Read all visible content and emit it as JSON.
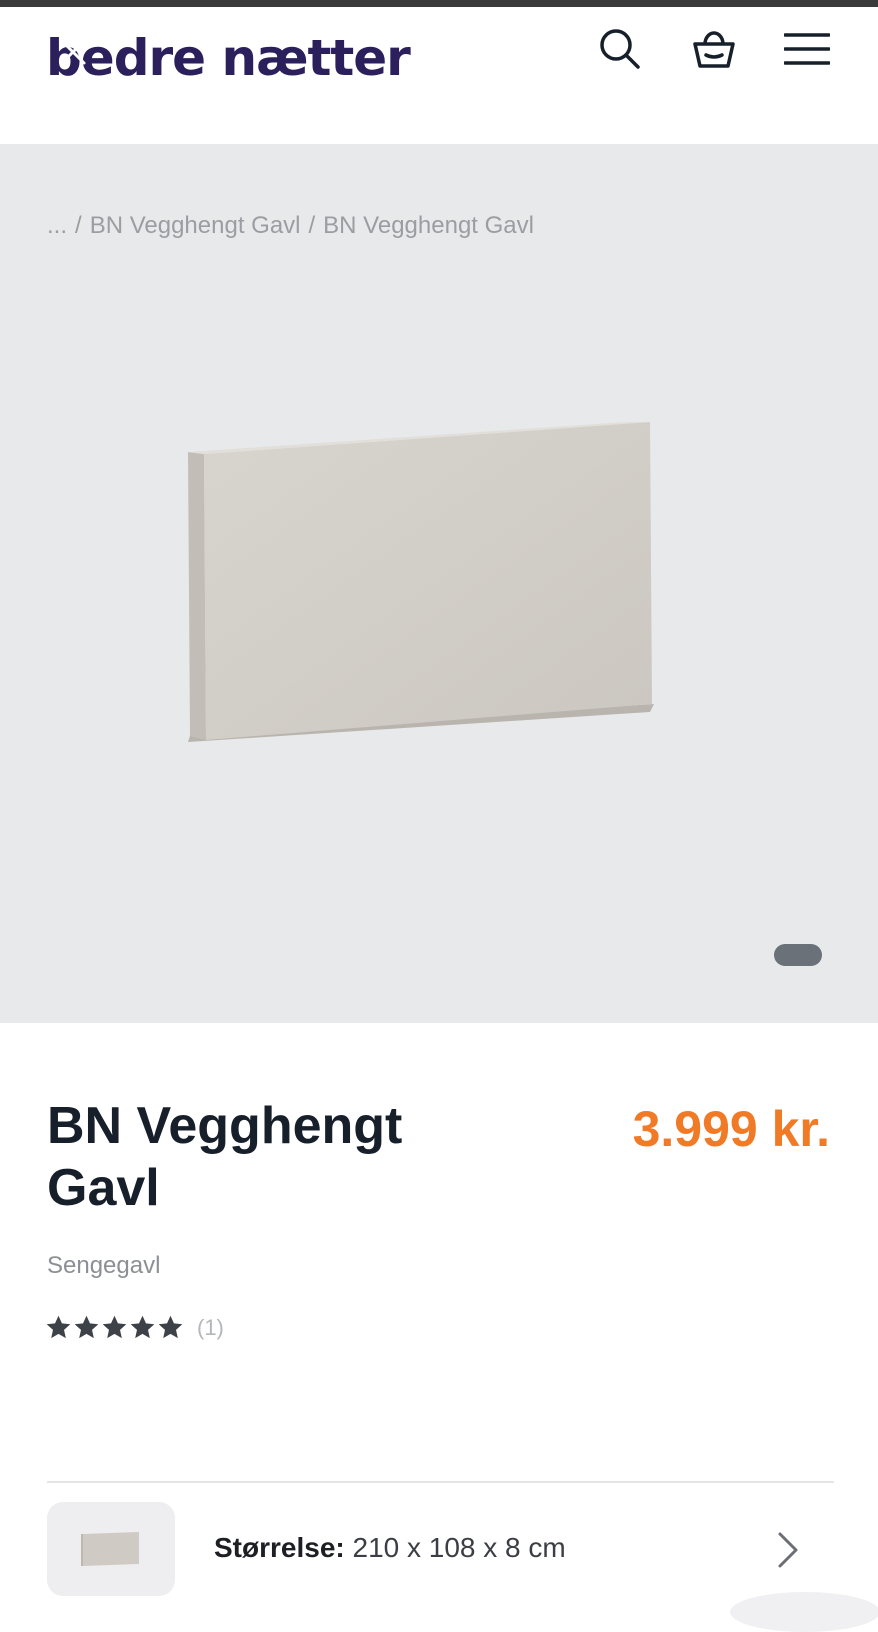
{
  "header": {
    "logo_text": "bedre nætter",
    "icons": [
      "close-icon",
      "moon-icon",
      "search-icon",
      "basket-icon",
      "menu-icon"
    ]
  },
  "breadcrumb": {
    "items": [
      "...",
      "BN Vegghengt Gavl",
      "BN Vegghengt Gavl"
    ],
    "separator": "/"
  },
  "gallery": {
    "active_index": 0,
    "total": 1
  },
  "product": {
    "title": "BN Vegghengt Gavl",
    "price": "3.999 kr.",
    "category": "Sengegavl",
    "rating": 5,
    "review_count": "(1)"
  },
  "size_selector": {
    "label": "Størrelse:",
    "value": "210 x 108 x 8 cm"
  },
  "colors": {
    "brand": "#2b1f5c",
    "accent": "#f07a26",
    "text": "#17202a",
    "hero_bg": "#e8e9eb"
  }
}
